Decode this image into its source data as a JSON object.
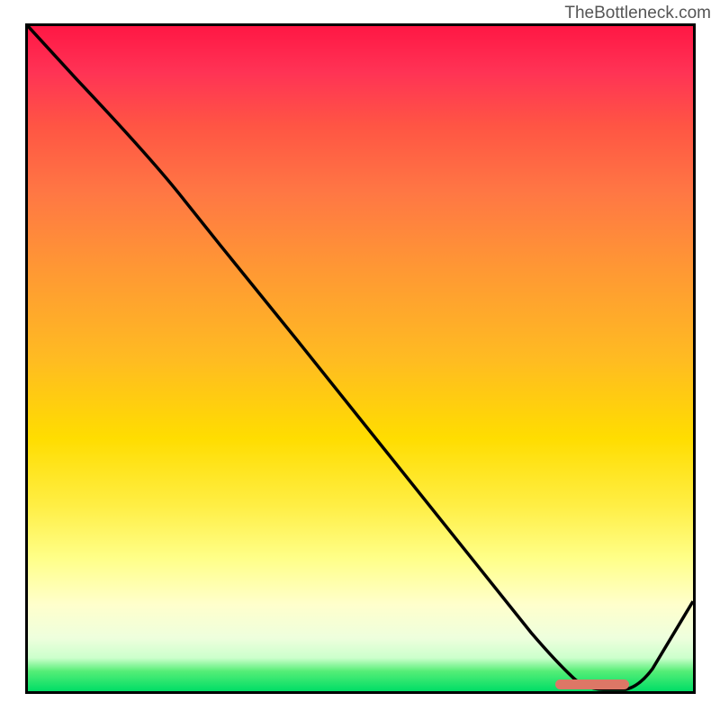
{
  "watermark": "TheBottleneck.com",
  "chart_data": {
    "type": "line",
    "title": "",
    "xlabel": "",
    "ylabel": "",
    "xlim": [
      0,
      100
    ],
    "ylim": [
      0,
      100
    ],
    "x": [
      0,
      10,
      20,
      30,
      40,
      50,
      60,
      70,
      75,
      80,
      85,
      90,
      100
    ],
    "values": [
      100,
      89,
      80,
      69,
      57,
      45,
      33,
      21,
      13,
      5,
      0,
      0,
      18
    ],
    "curve_description": "Descending curve from top-left, steep drop after inflection around x=25, reaching minimum near x=82-88, then rising to right edge",
    "target_marker": {
      "x_start": 79,
      "x_end": 90,
      "y": 0.5,
      "color": "#dd7766"
    },
    "gradient_colors": {
      "top": "#ff1744",
      "mid_high": "#ff9933",
      "mid": "#ffdd00",
      "mid_low": "#ffffcc",
      "bottom": "#00dd66"
    }
  }
}
